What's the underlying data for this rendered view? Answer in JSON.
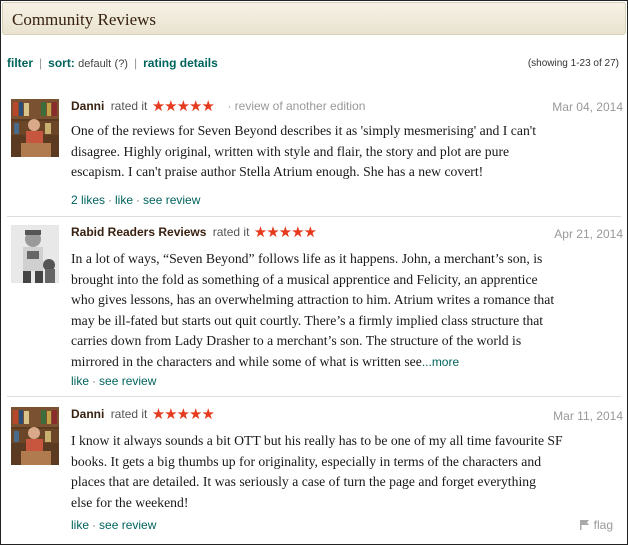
{
  "header": {
    "title": "Community Reviews"
  },
  "filterbar": {
    "filter_label": "filter",
    "sort_label": "sort:",
    "sort_value": "default",
    "sort_help": "(?)",
    "rating_details_label": "rating details",
    "showing": "(showing 1-23 of 27)"
  },
  "reviews": [
    {
      "user": "Danni",
      "rated_text": "rated it",
      "stars": "★★★★★",
      "edition_note": "review of another edition",
      "date": "Mar 04, 2014",
      "lines": [
        "One of the reviews for Seven Beyond describes it as 'simply mesmerising' and I can't",
        "disagree. Highly original, written with style and flair, the story and plot are pure",
        "escapism. I can't praise author Stella Atrium enough. She has a new covert!"
      ],
      "likes": "2 likes",
      "like": "like",
      "see_review": "see review"
    },
    {
      "user": "Rabid Readers Reviews",
      "rated_text": "rated it",
      "stars": "★★★★★",
      "date": "Apr 21, 2014",
      "lines": [
        "In a lot of ways, “Seven Beyond” follows life as it happens. John, a merchant’s son, is",
        "brought into the fold as something of a musical apprentice and Felicity, an apprentice",
        "who gives lessons, has an overwhelming attraction to him. Atrium writes a romance that",
        "may be ill-fated but starts out quit courtly. There’s a firmly implied class structure that",
        "carries down from Lady Drasher to a merchant’s son. The structure of the world is",
        "mirrored in the characters and while some of what is written see"
      ],
      "more": "...more",
      "like": "like",
      "see_review": "see review"
    },
    {
      "user": "Danni",
      "rated_text": "rated it",
      "stars": "★★★★★",
      "date": "Mar 11, 2014",
      "lines": [
        "I know it always sounds a bit OTT but his really has to be one of my all time favourite SF",
        "books. It gets a big thumbs up for originality, especially in terms of the characters and",
        "places that are detailed. It was seriously a case of turn the page and forget everything",
        "else for the weekend!"
      ],
      "like": "like",
      "see_review": "see review",
      "flag": "flag"
    }
  ]
}
